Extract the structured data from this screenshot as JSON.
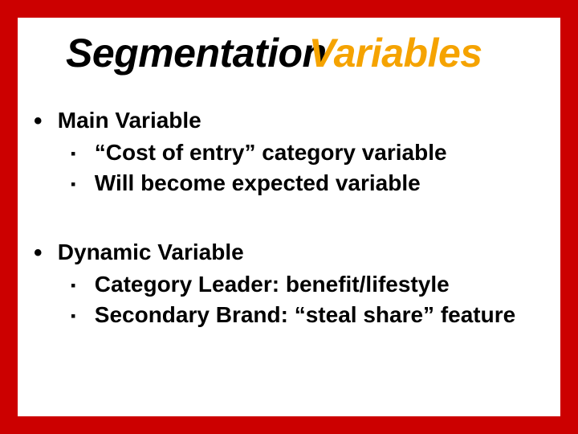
{
  "title": {
    "part1": "Segmentation",
    "part2": "Variables"
  },
  "sections": [
    {
      "heading": "Main Variable",
      "items": [
        "“Cost of entry” category variable",
        "Will become expected variable"
      ]
    },
    {
      "heading": "Dynamic Variable",
      "items": [
        "Category Leader: benefit/lifestyle",
        "Secondary Brand: “steal share” feature"
      ]
    }
  ]
}
